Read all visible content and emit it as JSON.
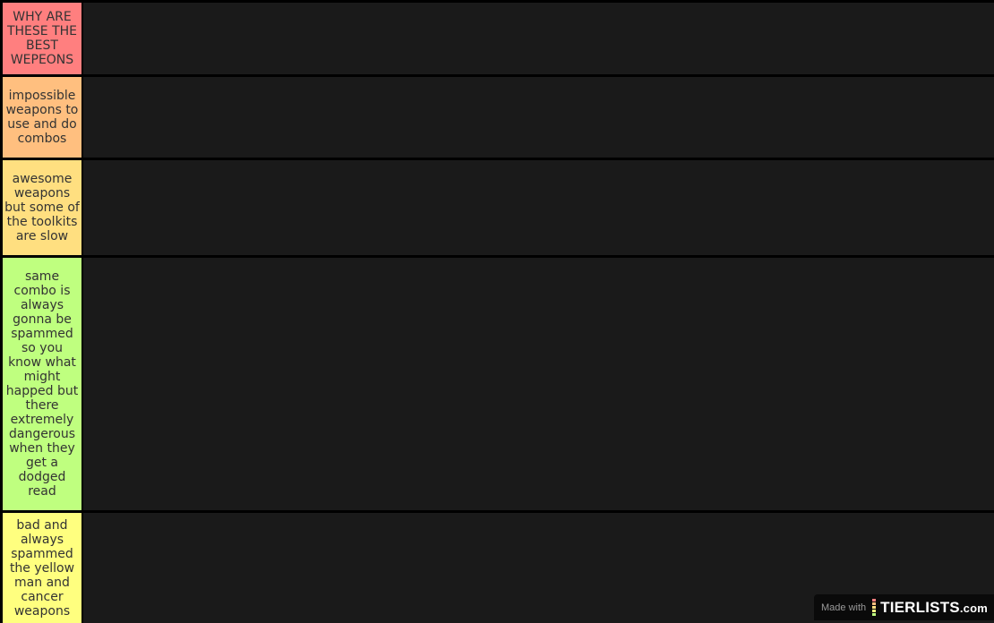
{
  "tiers": [
    {
      "label": "WHY ARE THESE THE BEST WEPEONS",
      "color": "#ff7f7f"
    },
    {
      "label": "impossible weapons to use and do combos",
      "color": "#ffbf7f"
    },
    {
      "label": "awesome weapons but some of the toolkits are slow",
      "color": "#ffdf80"
    },
    {
      "label": "same combo is always gonna be spammed so you know what might happed but there extremely dangerous when they get a dodged read",
      "color": "#bfff7f"
    },
    {
      "label": "bad and always spammed the yellow man and cancer weapons",
      "color": "#ffff7f"
    }
  ],
  "watermark": {
    "made_with": "Made with",
    "brand": "TIERLISTS",
    "tld": ".com",
    "bar_colors": [
      "#ff7f7f",
      "#ffbf7f",
      "#ffdf80",
      "#ffff7f",
      "#bfff7f"
    ]
  }
}
